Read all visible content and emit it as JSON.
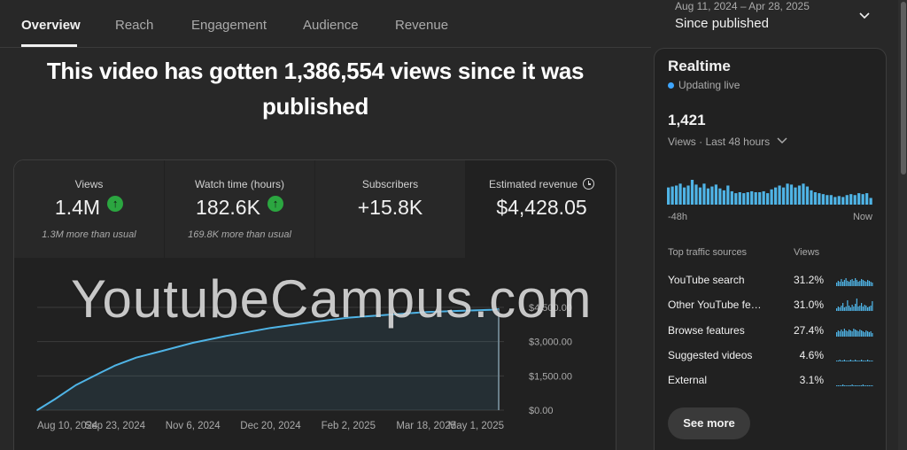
{
  "tabs": [
    {
      "label": "Overview",
      "active": true
    },
    {
      "label": "Reach",
      "active": false
    },
    {
      "label": "Engagement",
      "active": false
    },
    {
      "label": "Audience",
      "active": false
    },
    {
      "label": "Revenue",
      "active": false
    }
  ],
  "date_range": {
    "range": "Aug 11, 2024 – Apr 28, 2025",
    "label": "Since published"
  },
  "headline": "This video has gotten 1,386,554 views since it was published",
  "metrics": [
    {
      "title": "Views",
      "value": "1.4M",
      "trend": "up",
      "subtitle": "1.3M more than usual"
    },
    {
      "title": "Watch time (hours)",
      "value": "182.6K",
      "trend": "up",
      "subtitle": "169.8K more than usual"
    },
    {
      "title": "Subscribers",
      "value": "+15.8K",
      "trend": "",
      "subtitle": ""
    },
    {
      "title": "Estimated revenue",
      "value": "$4,428.05",
      "trend": "",
      "subtitle": "",
      "icon": "clock-icon"
    }
  ],
  "chart_data": {
    "type": "line",
    "title": "",
    "xlabel": "",
    "ylabel": "",
    "x": [
      "2024-08-10",
      "2024-08-20",
      "2024-09-01",
      "2024-09-15",
      "2024-09-23",
      "2024-10-05",
      "2024-10-20",
      "2024-11-06",
      "2024-11-25",
      "2024-12-20",
      "2025-01-15",
      "2025-02-02",
      "2025-02-25",
      "2025-03-18",
      "2025-04-10",
      "2025-04-25",
      "2025-04-28"
    ],
    "series": [
      {
        "values": [
          0,
          480,
          1100,
          1650,
          1950,
          2300,
          2600,
          2950,
          3250,
          3600,
          3880,
          4050,
          4180,
          4300,
          4360,
          4400,
          4428.05
        ]
      }
    ],
    "ylim": [
      0,
      4500
    ],
    "x_ticks": [
      "Aug 10, 2024",
      "Sep 23, 2024",
      "Nov 6, 2024",
      "Dec 20, 2024",
      "Feb 2, 2025",
      "Mar 18, 2025",
      "May 1, 2025"
    ],
    "x_tick_dates": [
      "2024-08-10",
      "2024-09-23",
      "2024-11-06",
      "2024-12-20",
      "2025-02-02",
      "2025-03-18",
      "2025-05-01"
    ],
    "y_ticks": [
      {
        "value": 0,
        "label": "$0.00"
      },
      {
        "value": 1500,
        "label": "$1,500.00"
      },
      {
        "value": 3000,
        "label": "$3,000.00"
      },
      {
        "value": 4500,
        "label": "$4,500.00"
      }
    ],
    "x_range": [
      "2024-08-10",
      "2025-05-01"
    ],
    "grid": true,
    "line_color": "#4fb4e6"
  },
  "watermark": "YoutubeCampus.com",
  "realtime": {
    "title": "Realtime",
    "status": "Updating live",
    "count": "1,421",
    "period": "Views · Last 48 hours",
    "axis_start": "-48h",
    "axis_end": "Now",
    "bar_values": [
      18,
      19,
      20,
      22,
      18,
      20,
      26,
      21,
      18,
      22,
      17,
      19,
      21,
      17,
      15,
      20,
      14,
      12,
      13,
      12,
      13,
      14,
      13,
      13,
      14,
      12,
      16,
      18,
      20,
      18,
      22,
      21,
      18,
      20,
      22,
      19,
      15,
      13,
      12,
      11,
      10,
      10,
      8,
      9,
      8,
      10,
      11,
      10,
      12,
      11,
      12,
      7
    ],
    "bar_color": "#4fb4e6",
    "traffic_header": "Top traffic sources",
    "views_header": "Views",
    "sources": [
      {
        "name": "YouTube search",
        "pct": "31.2%",
        "spark": [
          4,
          6,
          5,
          8,
          5,
          7,
          9,
          6,
          5,
          7,
          8,
          6,
          9,
          7,
          5,
          6,
          8,
          7,
          6,
          5,
          7,
          6,
          5,
          4
        ]
      },
      {
        "name": "Other YouTube fe…",
        "pct": "31.0%",
        "spark": [
          3,
          5,
          4,
          6,
          9,
          4,
          5,
          12,
          6,
          4,
          7,
          5,
          8,
          14,
          5,
          6,
          9,
          5,
          7,
          6,
          4,
          5,
          6,
          11
        ]
      },
      {
        "name": "Browse features",
        "pct": "27.4%",
        "spark": [
          5,
          7,
          6,
          8,
          6,
          9,
          7,
          6,
          8,
          7,
          6,
          9,
          8,
          7,
          6,
          8,
          7,
          6,
          5,
          7,
          6,
          5,
          6,
          4
        ]
      },
      {
        "name": "Suggested videos",
        "pct": "4.6%",
        "spark": [
          1,
          1,
          2,
          1,
          1,
          2,
          1,
          1,
          1,
          2,
          1,
          1,
          2,
          1,
          1,
          1,
          2,
          1,
          1,
          1,
          2,
          1,
          1,
          1
        ]
      },
      {
        "name": "External",
        "pct": "3.1%",
        "spark": [
          1,
          1,
          1,
          1,
          2,
          1,
          1,
          1,
          1,
          1,
          2,
          1,
          1,
          1,
          1,
          1,
          1,
          2,
          1,
          1,
          1,
          1,
          1,
          1
        ]
      }
    ],
    "see_more_label": "See more"
  }
}
